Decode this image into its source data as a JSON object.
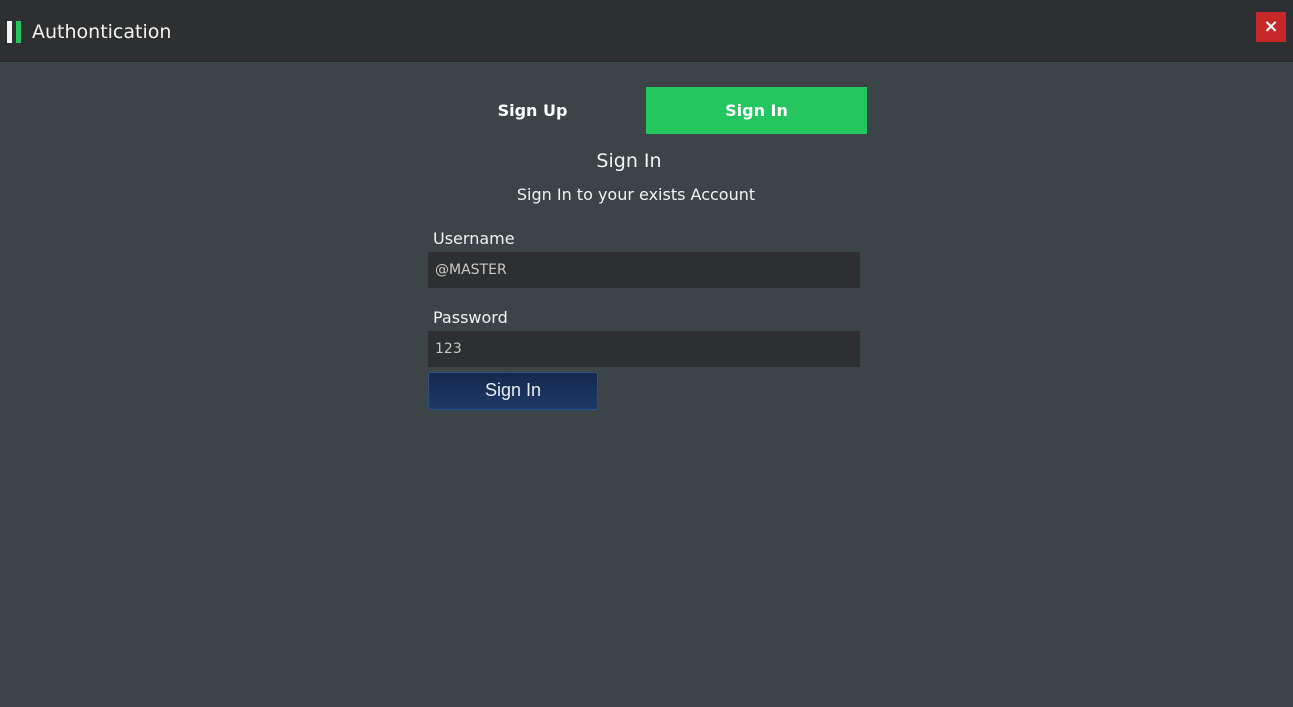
{
  "window": {
    "title": "Authontication",
    "close_symbol": "×",
    "icons": {
      "logo": "two-bar-logo-icon",
      "close": "close-icon"
    }
  },
  "tabs": [
    {
      "label": "Sign Up",
      "active": false
    },
    {
      "label": "Sign In",
      "active": true
    }
  ],
  "form": {
    "heading": "Sign In",
    "subheading": "Sign In to your exists Account",
    "username_label": "Username",
    "username_value": "@MASTER",
    "password_label": "Password",
    "password_value": "123",
    "submit_label": "Sign In"
  },
  "colors": {
    "accent": "#22c55e",
    "close": "#c62828",
    "titlebar": "#2d2f30",
    "background": "#3c4447",
    "input_background": "#2d2f30",
    "button": "#1d3a66"
  }
}
